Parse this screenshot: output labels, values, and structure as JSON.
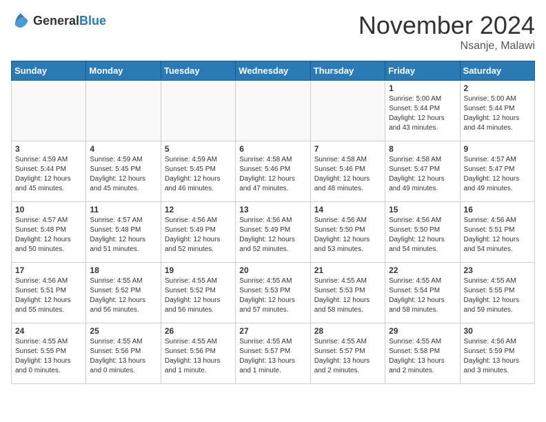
{
  "logo": {
    "general": "General",
    "blue": "Blue"
  },
  "header": {
    "month": "November 2024",
    "location": "Nsanje, Malawi"
  },
  "weekdays": [
    "Sunday",
    "Monday",
    "Tuesday",
    "Wednesday",
    "Thursday",
    "Friday",
    "Saturday"
  ],
  "weeks": [
    [
      {
        "day": "",
        "info": ""
      },
      {
        "day": "",
        "info": ""
      },
      {
        "day": "",
        "info": ""
      },
      {
        "day": "",
        "info": ""
      },
      {
        "day": "",
        "info": ""
      },
      {
        "day": "1",
        "info": "Sunrise: 5:00 AM\nSunset: 5:44 PM\nDaylight: 12 hours and 43 minutes."
      },
      {
        "day": "2",
        "info": "Sunrise: 5:00 AM\nSunset: 5:44 PM\nDaylight: 12 hours and 44 minutes."
      }
    ],
    [
      {
        "day": "3",
        "info": "Sunrise: 4:59 AM\nSunset: 5:44 PM\nDaylight: 12 hours and 45 minutes."
      },
      {
        "day": "4",
        "info": "Sunrise: 4:59 AM\nSunset: 5:45 PM\nDaylight: 12 hours and 45 minutes."
      },
      {
        "day": "5",
        "info": "Sunrise: 4:59 AM\nSunset: 5:45 PM\nDaylight: 12 hours and 46 minutes."
      },
      {
        "day": "6",
        "info": "Sunrise: 4:58 AM\nSunset: 5:46 PM\nDaylight: 12 hours and 47 minutes."
      },
      {
        "day": "7",
        "info": "Sunrise: 4:58 AM\nSunset: 5:46 PM\nDaylight: 12 hours and 48 minutes."
      },
      {
        "day": "8",
        "info": "Sunrise: 4:58 AM\nSunset: 5:47 PM\nDaylight: 12 hours and 49 minutes."
      },
      {
        "day": "9",
        "info": "Sunrise: 4:57 AM\nSunset: 5:47 PM\nDaylight: 12 hours and 49 minutes."
      }
    ],
    [
      {
        "day": "10",
        "info": "Sunrise: 4:57 AM\nSunset: 5:48 PM\nDaylight: 12 hours and 50 minutes."
      },
      {
        "day": "11",
        "info": "Sunrise: 4:57 AM\nSunset: 5:48 PM\nDaylight: 12 hours and 51 minutes."
      },
      {
        "day": "12",
        "info": "Sunrise: 4:56 AM\nSunset: 5:49 PM\nDaylight: 12 hours and 52 minutes."
      },
      {
        "day": "13",
        "info": "Sunrise: 4:56 AM\nSunset: 5:49 PM\nDaylight: 12 hours and 52 minutes."
      },
      {
        "day": "14",
        "info": "Sunrise: 4:56 AM\nSunset: 5:50 PM\nDaylight: 12 hours and 53 minutes."
      },
      {
        "day": "15",
        "info": "Sunrise: 4:56 AM\nSunset: 5:50 PM\nDaylight: 12 hours and 54 minutes."
      },
      {
        "day": "16",
        "info": "Sunrise: 4:56 AM\nSunset: 5:51 PM\nDaylight: 12 hours and 54 minutes."
      }
    ],
    [
      {
        "day": "17",
        "info": "Sunrise: 4:56 AM\nSunset: 5:51 PM\nDaylight: 12 hours and 55 minutes."
      },
      {
        "day": "18",
        "info": "Sunrise: 4:55 AM\nSunset: 5:52 PM\nDaylight: 12 hours and 56 minutes."
      },
      {
        "day": "19",
        "info": "Sunrise: 4:55 AM\nSunset: 5:52 PM\nDaylight: 12 hours and 56 minutes."
      },
      {
        "day": "20",
        "info": "Sunrise: 4:55 AM\nSunset: 5:53 PM\nDaylight: 12 hours and 57 minutes."
      },
      {
        "day": "21",
        "info": "Sunrise: 4:55 AM\nSunset: 5:53 PM\nDaylight: 12 hours and 58 minutes."
      },
      {
        "day": "22",
        "info": "Sunrise: 4:55 AM\nSunset: 5:54 PM\nDaylight: 12 hours and 58 minutes."
      },
      {
        "day": "23",
        "info": "Sunrise: 4:55 AM\nSunset: 5:55 PM\nDaylight: 12 hours and 59 minutes."
      }
    ],
    [
      {
        "day": "24",
        "info": "Sunrise: 4:55 AM\nSunset: 5:55 PM\nDaylight: 13 hours and 0 minutes."
      },
      {
        "day": "25",
        "info": "Sunrise: 4:55 AM\nSunset: 5:56 PM\nDaylight: 13 hours and 0 minutes."
      },
      {
        "day": "26",
        "info": "Sunrise: 4:55 AM\nSunset: 5:56 PM\nDaylight: 13 hours and 1 minute."
      },
      {
        "day": "27",
        "info": "Sunrise: 4:55 AM\nSunset: 5:57 PM\nDaylight: 13 hours and 1 minute."
      },
      {
        "day": "28",
        "info": "Sunrise: 4:55 AM\nSunset: 5:57 PM\nDaylight: 13 hours and 2 minutes."
      },
      {
        "day": "29",
        "info": "Sunrise: 4:55 AM\nSunset: 5:58 PM\nDaylight: 13 hours and 2 minutes."
      },
      {
        "day": "30",
        "info": "Sunrise: 4:56 AM\nSunset: 5:59 PM\nDaylight: 13 hours and 3 minutes."
      }
    ]
  ]
}
